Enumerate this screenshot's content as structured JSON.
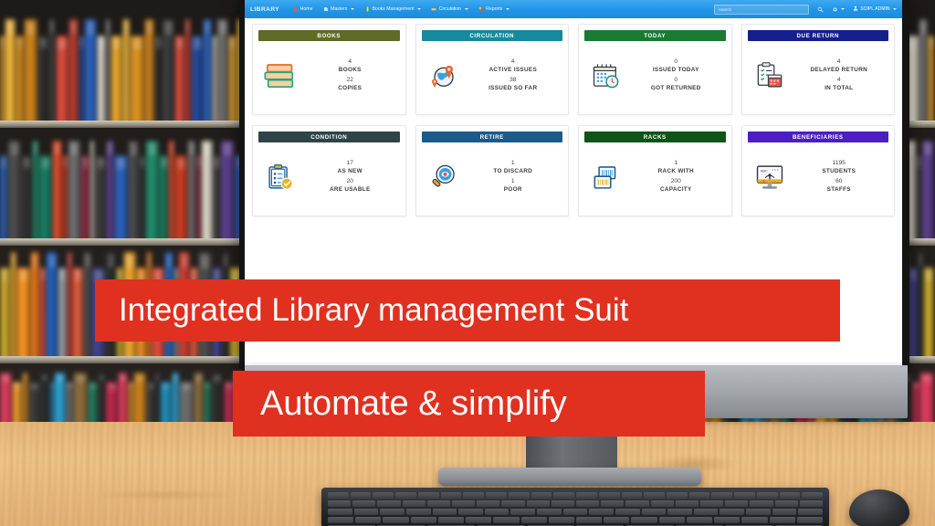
{
  "scene": {
    "description": "desktop monitor on wooden desk in front of library bookshelf",
    "banner_color": "#e03020"
  },
  "navbar": {
    "brand": "LIBRARY",
    "items": [
      {
        "label": "Home",
        "icon": "home-icon",
        "caret": false
      },
      {
        "label": "Masters",
        "icon": "masters-icon",
        "caret": true
      },
      {
        "label": "Books Management",
        "icon": "book-icon",
        "caret": true
      },
      {
        "label": "Circulation",
        "icon": "circulation-icon",
        "caret": true
      },
      {
        "label": "Reports",
        "icon": "reports-icon",
        "caret": true
      }
    ],
    "search": {
      "placeholder": "search",
      "value": "",
      "icon": "search-icon"
    },
    "settings_icon": "gear-icon",
    "user": {
      "label": "SOIPL.ADMIN",
      "icon": "user-icon"
    }
  },
  "dashboard": {
    "rows": [
      [
        {
          "title": "BOOKS",
          "color": "#5f6b26",
          "icon": "books-stack-icon",
          "stats": [
            {
              "num": "4",
              "label": "BOOKS"
            },
            {
              "num": "22",
              "label": "COPIES"
            }
          ]
        },
        {
          "title": "CIRCULATION",
          "color": "#17899c",
          "icon": "globe-pin-icon",
          "stats": [
            {
              "num": "4",
              "label": "ACTIVE ISSUES"
            },
            {
              "num": "38",
              "label": "ISSUED SO FAR"
            }
          ]
        },
        {
          "title": "TODAY",
          "color": "#1a7a32",
          "icon": "calendar-clock-icon",
          "stats": [
            {
              "num": "0",
              "label": "ISSUED TODAY"
            },
            {
              "num": "0",
              "label": "GOT RETURNED"
            }
          ]
        },
        {
          "title": "DUE RETURN",
          "color": "#141f8c",
          "icon": "checklist-calendar-icon",
          "stats": [
            {
              "num": "4",
              "label": "DELAYED RETURN"
            },
            {
              "num": "4",
              "label": "IN TOTAL"
            }
          ]
        }
      ],
      [
        {
          "title": "CONDITION",
          "color": "#2f4446",
          "icon": "clipboard-check-icon",
          "stats": [
            {
              "num": "17",
              "label": "AS NEW"
            },
            {
              "num": "20",
              "label": "ARE USABLE"
            }
          ]
        },
        {
          "title": "RETIRE",
          "color": "#1b5a8a",
          "icon": "magnifier-eye-icon",
          "stats": [
            {
              "num": "1",
              "label": "TO DISCARD"
            },
            {
              "num": "1",
              "label": "POOR"
            }
          ]
        },
        {
          "title": "RACKS",
          "color": "#0f5418",
          "icon": "barcode-rack-icon",
          "stats": [
            {
              "num": "1",
              "label": "RACK WITH"
            },
            {
              "num": "200",
              "label": "CAPACITY"
            }
          ]
        },
        {
          "title": "BENEFICIARIES",
          "color": "#4b1fc4",
          "icon": "monitor-abc-icon",
          "stats": [
            {
              "num": "1195",
              "label": "STUDENTS"
            },
            {
              "num": "60",
              "label": "STAFFS"
            }
          ]
        }
      ]
    ]
  },
  "overlay": {
    "headline": "Integrated Library management Suit",
    "subline": "Automate & simplify"
  }
}
